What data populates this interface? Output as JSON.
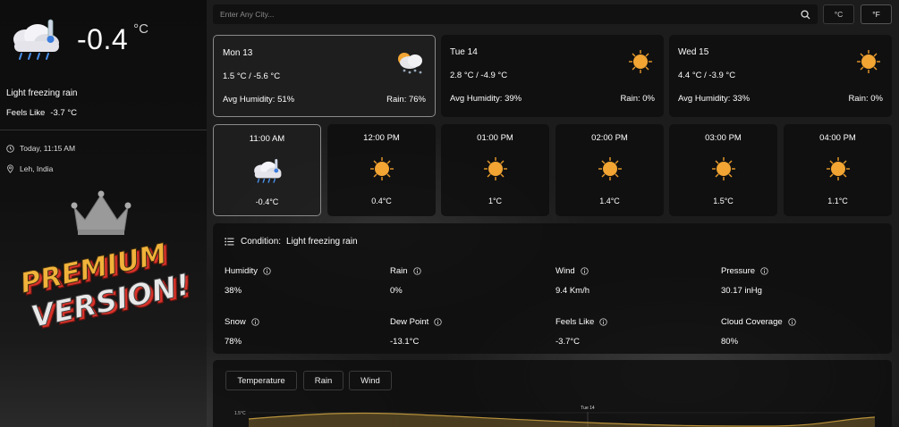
{
  "current": {
    "temp": "-0.4",
    "unit": "°C",
    "condition": "Light freezing rain",
    "feels_like_label": "Feels Like",
    "feels_like_value": "-3.7 °C",
    "datetime": "Today, 11:15 AM",
    "location": "Leh, India",
    "icon": "cloud-rain-thermometer-icon"
  },
  "promo": {
    "line1": "PREMIUM",
    "line2": "VERSION!"
  },
  "search": {
    "placeholder": "Enter Any City..."
  },
  "units": {
    "celsius": "°C",
    "fahrenheit": "°F"
  },
  "days": [
    {
      "day": "Mon 13",
      "range": "1.5 °C / -5.6 °C",
      "humidity": "Avg Humidity: 51%",
      "rain": "Rain: 76%",
      "icon": "sun-cloud-snow-icon"
    },
    {
      "day": "Tue 14",
      "range": "2.8 °C / -4.9 °C",
      "humidity": "Avg Humidity: 39%",
      "rain": "Rain: 0%",
      "icon": "sun-icon"
    },
    {
      "day": "Wed 15",
      "range": "4.4 °C / -3.9 °C",
      "humidity": "Avg Humidity: 33%",
      "rain": "Rain: 0%",
      "icon": "sun-icon"
    }
  ],
  "hours": [
    {
      "time": "11:00 AM",
      "temp": "-0.4°C",
      "icon": "cloud-rain-thermometer-icon"
    },
    {
      "time": "12:00 PM",
      "temp": "0.4°C",
      "icon": "sun-icon"
    },
    {
      "time": "01:00 PM",
      "temp": "1°C",
      "icon": "sun-icon"
    },
    {
      "time": "02:00 PM",
      "temp": "1.4°C",
      "icon": "sun-icon"
    },
    {
      "time": "03:00 PM",
      "temp": "1.5°C",
      "icon": "sun-icon"
    },
    {
      "time": "04:00 PM",
      "temp": "1.1°C",
      "icon": "sun-icon"
    }
  ],
  "details": {
    "condition_label": "Condition:",
    "condition_value": "Light freezing rain",
    "stats": [
      {
        "label": "Humidity",
        "value": "38%"
      },
      {
        "label": "Rain",
        "value": "0%"
      },
      {
        "label": "Wind",
        "value": "9.4 Km/h"
      },
      {
        "label": "Pressure",
        "value": "30.17 inHg"
      },
      {
        "label": "Snow",
        "value": "78%"
      },
      {
        "label": "Dew Point",
        "value": "-13.1°C"
      },
      {
        "label": "Feels Like",
        "value": "-3.7°C"
      },
      {
        "label": "Cloud Coverage",
        "value": "80%"
      }
    ]
  },
  "chart": {
    "tabs": [
      "Temperature",
      "Rain",
      "Wind"
    ],
    "y_tick": "1.5°C",
    "x_marker": "Tue 14"
  },
  "colors": {
    "accent_sun": "#f2a533",
    "chart_line": "#b8923c"
  }
}
